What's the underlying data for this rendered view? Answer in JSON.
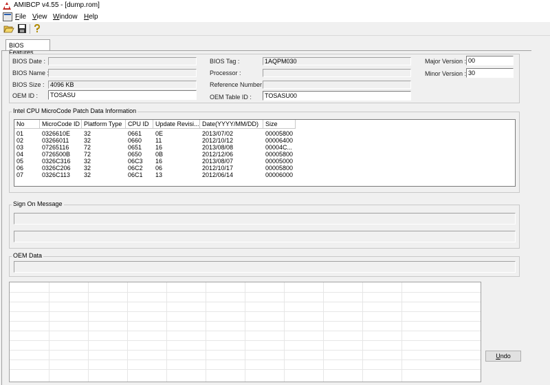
{
  "window": {
    "title": "AMIBCP v4.55 - [dump.rom]"
  },
  "menu": {
    "file": "File",
    "view": "View",
    "window": "Window",
    "help": "Help"
  },
  "tabs": [
    {
      "label": "BIOS Features"
    }
  ],
  "bios": {
    "date_label": "BIOS Date :",
    "date_value": "",
    "name_label": "BIOS Name :",
    "name_value": "",
    "size_label": "BIOS Size :",
    "size_value": "4096 KB",
    "oem_id_label": "OEM ID :",
    "oem_id_value": "TOSASU",
    "tag_label": "BIOS Tag :",
    "tag_value": "1AQPM030",
    "processor_label": "Processor :",
    "processor_value": "",
    "refnum_label": "Reference Number :",
    "refnum_value": "",
    "oem_table_label": "OEM Table ID :",
    "oem_table_value": "TOSASU00",
    "major_label": "Major Version :",
    "major_value": "00",
    "minor_label": "Minor Version :",
    "minor_value": "30"
  },
  "microcode": {
    "group_title": "Intel CPU MicroCode Patch Data Information",
    "columns": [
      "No",
      "MicroCode ID",
      "Platform Type",
      "CPU ID",
      "Update Revisi...",
      "Date(YYYY/MM/DD)",
      "Size"
    ],
    "rows": [
      [
        "01",
        "0326610E",
        "32",
        "0661",
        "0E",
        "2013/07/02",
        "00005800"
      ],
      [
        "02",
        "03266011",
        "32",
        "0660",
        "11",
        "2012/10/12",
        "00006400"
      ],
      [
        "03",
        "07265116",
        "72",
        "0651",
        "16",
        "2013/08/08",
        "00004C..."
      ],
      [
        "04",
        "0726500B",
        "72",
        "0650",
        "0B",
        "2012/12/06",
        "00005800"
      ],
      [
        "05",
        "0326C316",
        "32",
        "06C3",
        "16",
        "2013/08/07",
        "00005000"
      ],
      [
        "06",
        "0326C206",
        "32",
        "06C2",
        "06",
        "2012/10/17",
        "00005800"
      ],
      [
        "07",
        "0326C113",
        "32",
        "06C1",
        "13",
        "2012/06/14",
        "00006000"
      ]
    ]
  },
  "signon": {
    "group_title": "Sign On Message",
    "line1": "",
    "line2": ""
  },
  "oemdata": {
    "group_title": "OEM Data",
    "value": ""
  },
  "buttons": {
    "undo_u": "U",
    "undo_rest": "ndo"
  },
  "colors": {
    "titlebar_bg": "#ffffff",
    "window_bg": "#f0f0f0",
    "logo": "#c0241f"
  }
}
